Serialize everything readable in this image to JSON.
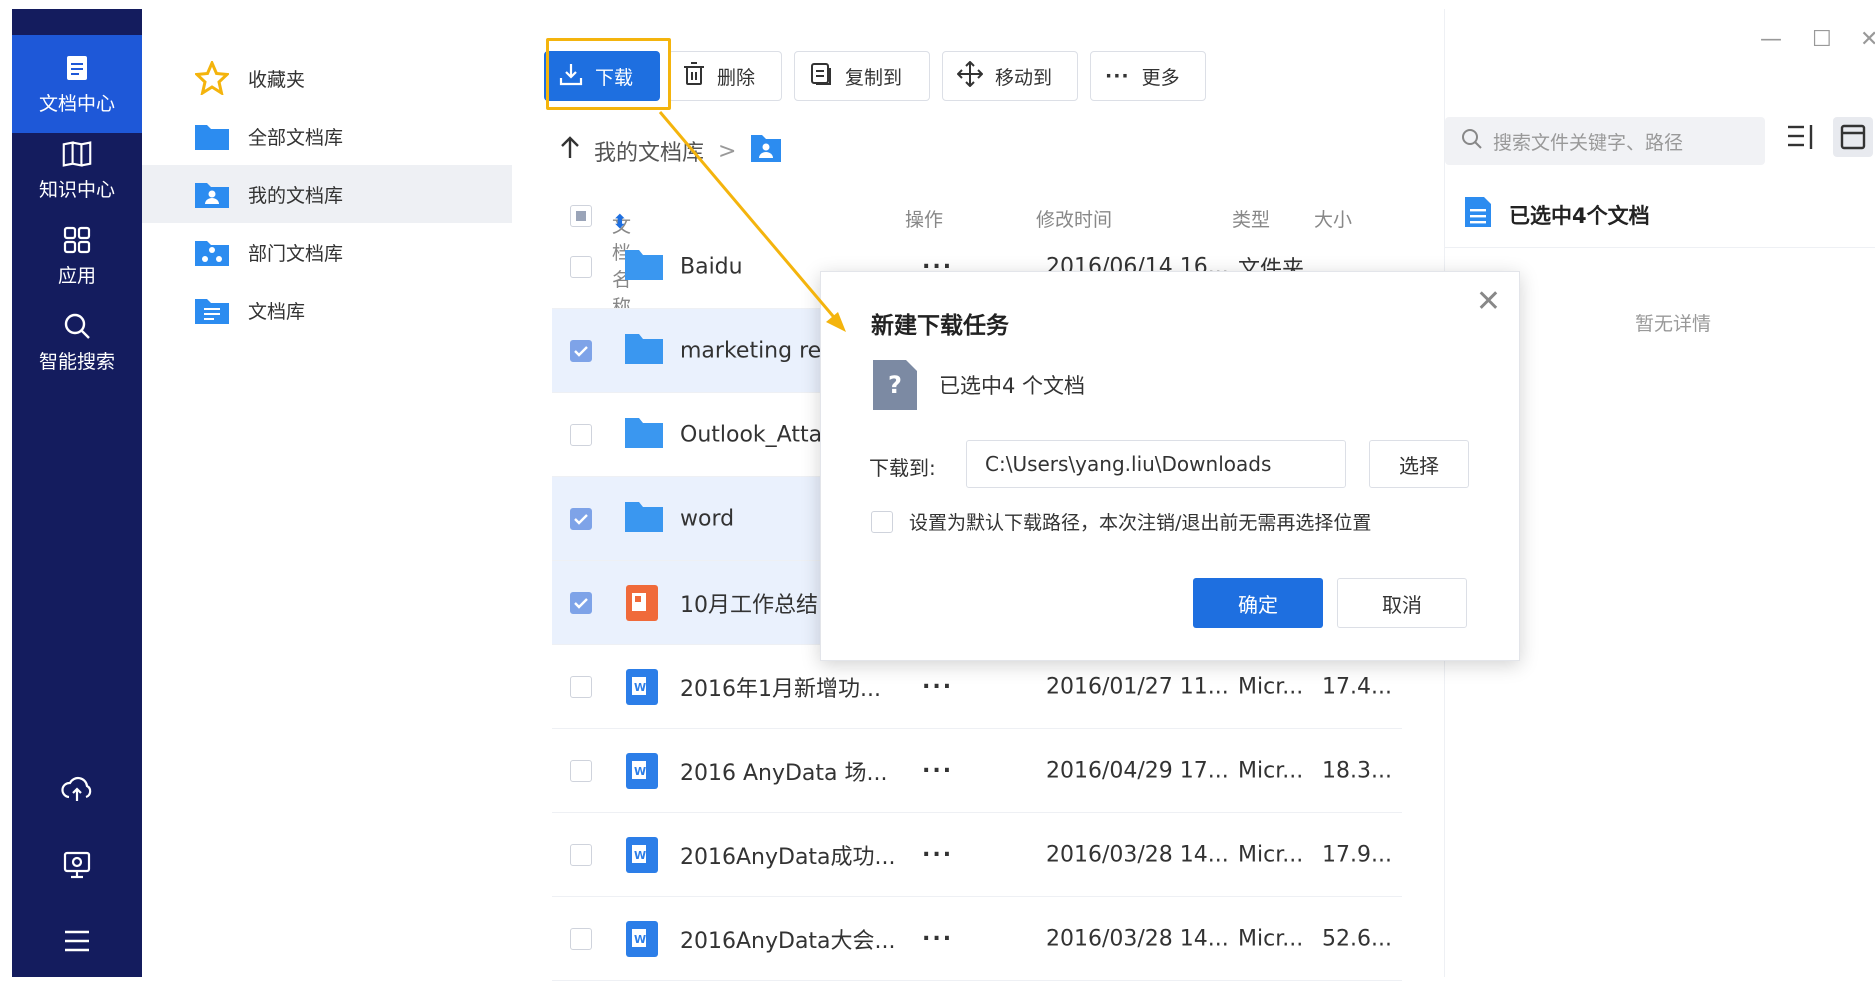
{
  "rail": {
    "items": [
      {
        "label": "文档中心",
        "icon": "document-icon"
      },
      {
        "label": "知识中心",
        "icon": "book-icon"
      },
      {
        "label": "应用",
        "icon": "apps-icon"
      },
      {
        "label": "智能搜索",
        "icon": "search-icon"
      }
    ],
    "bottom_icons": [
      "cloud-upload-icon",
      "transfer-icon",
      "menu-icon"
    ]
  },
  "libraries": [
    {
      "label": "收藏夹",
      "icon": "star-icon"
    },
    {
      "label": "全部文档库",
      "icon": "folder-icon"
    },
    {
      "label": "我的文档库",
      "icon": "user-folder-icon"
    },
    {
      "label": "部门文档库",
      "icon": "org-folder-icon"
    },
    {
      "label": "文档库",
      "icon": "doc-folder-icon"
    }
  ],
  "toolbar": {
    "download": "下载",
    "delete": "删除",
    "copy_to": "复制到",
    "move_to": "移动到",
    "more": "更多"
  },
  "breadcrumb": {
    "path": "我的文档库",
    "separator": ">"
  },
  "columns": {
    "name": "文档名称",
    "ops": "操作",
    "mtime": "修改时间",
    "type": "类型",
    "size": "大小"
  },
  "rows": [
    {
      "name": "Baidu",
      "ops": "···",
      "mtime": "2016/06/14 16...",
      "type": "文件夹",
      "size": "",
      "kind": "folder",
      "checked": false
    },
    {
      "name": "marketing re",
      "ops": "",
      "mtime": "",
      "type": "",
      "size": "",
      "kind": "folder",
      "checked": true
    },
    {
      "name": "Outlook_Atta",
      "ops": "",
      "mtime": "",
      "type": "",
      "size": "",
      "kind": "folder",
      "checked": false
    },
    {
      "name": "word",
      "ops": "",
      "mtime": "",
      "type": "",
      "size": "",
      "kind": "folder",
      "checked": true
    },
    {
      "name": "10月工作总结",
      "ops": "",
      "mtime": "",
      "type": "",
      "size": "",
      "kind": "ppt",
      "checked": true
    },
    {
      "name": "2016年1月新增功...",
      "ops": "···",
      "mtime": "2016/01/27 11...",
      "type": "Micr...",
      "size": "17.4...",
      "kind": "word",
      "checked": false
    },
    {
      "name": "2016 AnyData 场...",
      "ops": "···",
      "mtime": "2016/04/29 17...",
      "type": "Micr...",
      "size": "18.3...",
      "kind": "word",
      "checked": false
    },
    {
      "name": "2016AnyData成功...",
      "ops": "···",
      "mtime": "2016/03/28 14...",
      "type": "Micr...",
      "size": "17.9...",
      "kind": "word",
      "checked": false
    },
    {
      "name": "2016AnyData大会...",
      "ops": "···",
      "mtime": "2016/03/28 14...",
      "type": "Micr...",
      "size": "52.6...",
      "kind": "word",
      "checked": false
    }
  ],
  "right_panel": {
    "search_placeholder": "搜索文件关键字、路径",
    "selected_title": "已选中4个文档",
    "no_detail": "暂无详情"
  },
  "dialog": {
    "title": "新建下载任务",
    "selected_text": "已选中4 个文档",
    "download_to_label": "下载到:",
    "path_value": "C:\\Users\\yang.liu\\Downloads",
    "choose_button": "选择",
    "default_checkbox_label": "设置为默认下载路径，本次注销/退出前无需再选择位置",
    "ok_button": "确定",
    "cancel_button": "取消"
  },
  "colors": {
    "rail_bg": "#141c5e",
    "accent": "#1e6fe0",
    "highlight": "#f4b40d",
    "selected_row": "#eaf1fd"
  }
}
